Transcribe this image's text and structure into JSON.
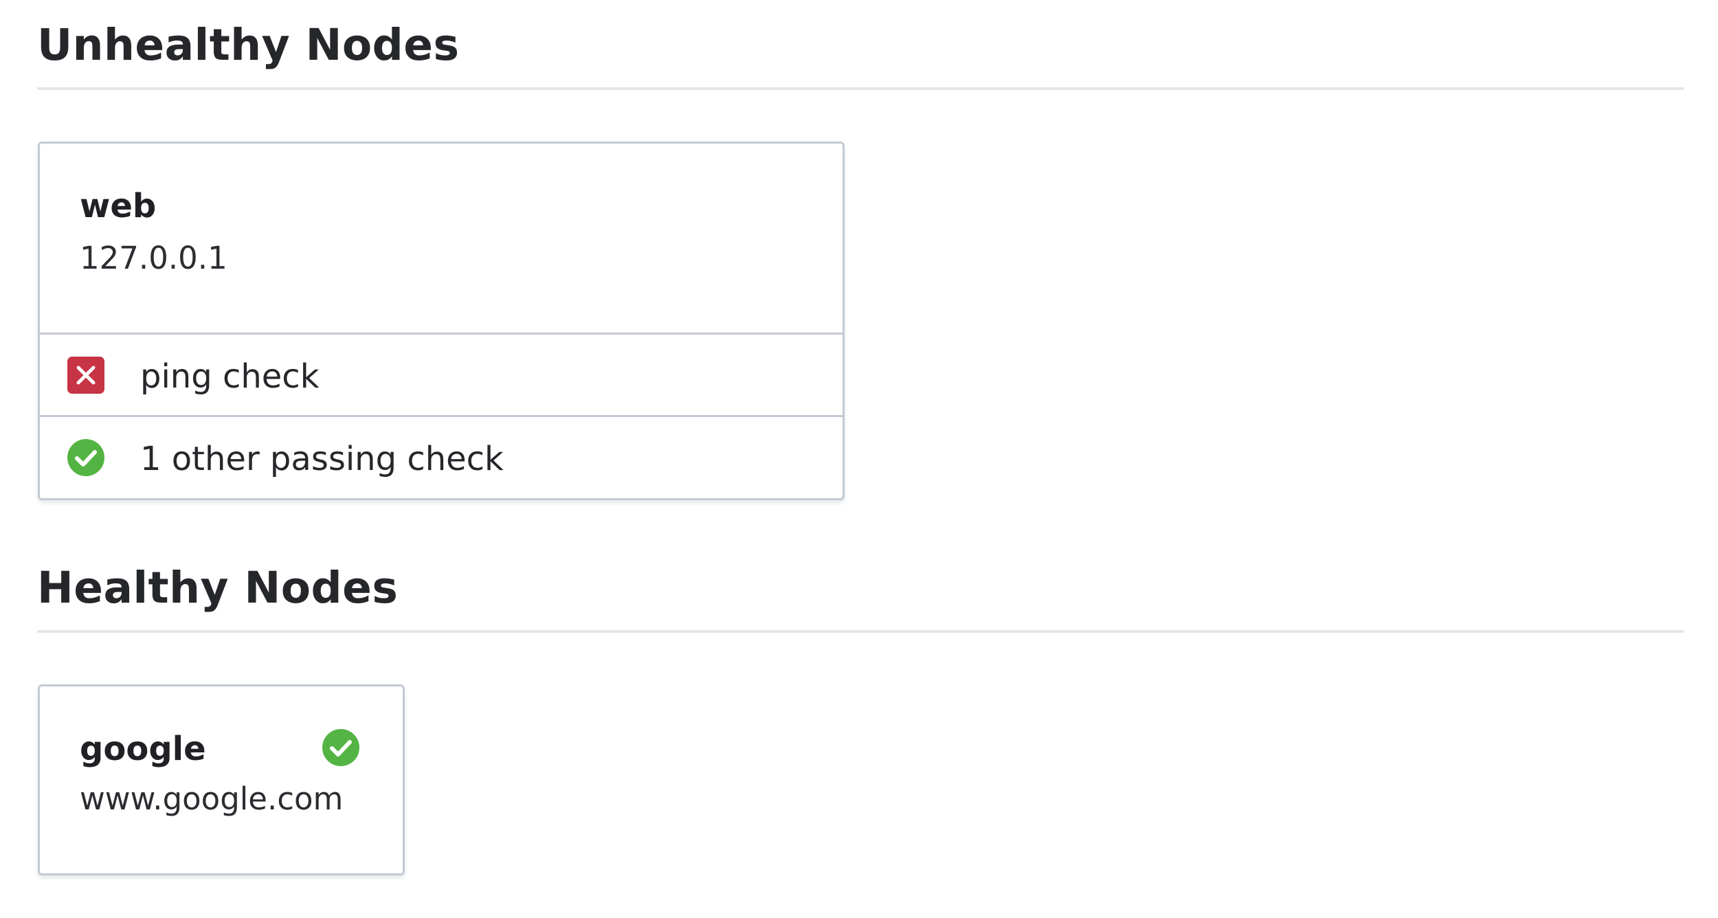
{
  "unhealthy": {
    "title": "Unhealthy Nodes",
    "nodes": [
      {
        "name": "web",
        "address": "127.0.0.1",
        "checks": [
          {
            "label": "ping check",
            "status": "critical",
            "icon": "x-square-icon"
          },
          {
            "label": "1 other passing check",
            "status": "passing",
            "icon": "check-circle-icon"
          }
        ]
      }
    ]
  },
  "healthy": {
    "title": "Healthy Nodes",
    "nodes": [
      {
        "name": "google",
        "address": "www.google.com",
        "status": "passing",
        "icon": "check-circle-icon"
      }
    ]
  },
  "colors": {
    "critical": "#c73445",
    "passing": "#54b443",
    "border": "#c4cad4",
    "divider": "#e5e6e9"
  }
}
